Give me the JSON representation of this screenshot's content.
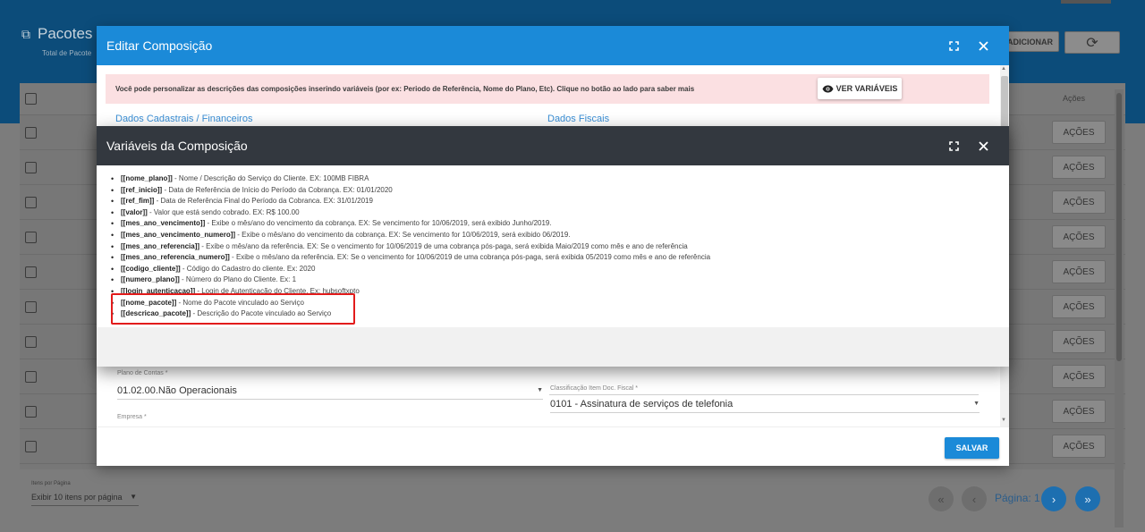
{
  "background": {
    "title": "Pacotes",
    "subtitle": "Total de Pacote",
    "add_button": "ADICIONAR",
    "refresh_icon": "refresh-icon",
    "acoes_header": "Ações",
    "row_action": "AÇÕES",
    "per_page_label": "Itens por Página",
    "per_page_value": "Exibir 10 itens por página",
    "page_label": "Página: 1"
  },
  "edit_modal": {
    "title": "Editar Composição",
    "alert_text": "Você pode personalizar as descrições das composições inserindo variáveis (por ex: Periodo de Referência, Nome do Plano, Etc). Clique no botão ao lado para saber mais",
    "ver_variaveis": "VER VARIÁVEIS",
    "tab_cadastrais": "Dados Cadastrais / Financeiros",
    "tab_fiscais": "Dados Fiscais",
    "plano_contas_label": "Plano de Contas *",
    "plano_contas_value": "01.02.00.Não Operacionais",
    "classificacao_label": "Classificação Item Doc. Fiscal *",
    "classificacao_value": "0101 - Assinatura de serviços de telefonia",
    "empresa_label": "Empresa *",
    "save_button": "SALVAR"
  },
  "vars_modal": {
    "title": "Variáveis da Composição",
    "items": [
      {
        "name": "[[nome_plano]]",
        "desc": " - Nome / Descrição do Serviço do Cliente. EX: 100MB FIBRA"
      },
      {
        "name": "[[ref_inicio]]",
        "desc": " - Data de Referência de Início do Período da Cobrança. EX: 01/01/2020"
      },
      {
        "name": "[[ref_fim]]",
        "desc": " - Data de Referência Final do Período da Cobranca. EX: 31/01/2019"
      },
      {
        "name": "[[valor]]",
        "desc": " - Valor que está sendo cobrado. EX: R$ 100.00"
      },
      {
        "name": "[[mes_ano_vencimento]]",
        "desc": " - Exibe o mês/ano do vencimento da cobrança. EX: Se vencimento for 10/06/2019, será exibido Junho/2019."
      },
      {
        "name": "[[mes_ano_vencimento_numero]]",
        "desc": " - Exibe o mês/ano do vencimento da cobrança. EX: Se vencimento for 10/06/2019, será exibido 06/2019."
      },
      {
        "name": "[[mes_ano_referencia]]",
        "desc": " - Exibe o mês/ano da referência. EX: Se o vencimento for 10/06/2019 de uma cobrança pós-paga, será exibida Maio/2019 como mês e ano de referência"
      },
      {
        "name": "[[mes_ano_referencia_numero]]",
        "desc": " - Exibe o mês/ano da referência. EX: Se o vencimento for 10/06/2019 de uma cobrança pós-paga, será exibida 05/2019 como mês e ano de referência"
      },
      {
        "name": "[[codigo_cliente]]",
        "desc": " - Código do Cadastro do cliente. Ex: 2020"
      },
      {
        "name": "[[numero_plano]]",
        "desc": " - Número do Plano do Cliente. Ex: 1"
      },
      {
        "name": "[[login_autenticacao]]",
        "desc": " - Login de Autenticação do Cliente. Ex: hubsoftxpto"
      },
      {
        "name": "[[nome_pacote]]",
        "desc": " - Nome do Pacote vinculado ao Serviço"
      },
      {
        "name": "[[descricao_pacote]]",
        "desc": " - Descrição do Pacote vinculado ao Serviço"
      }
    ]
  },
  "colors": {
    "edit_header": "#1b8ad8",
    "vars_header": "#33383f",
    "alert_bg": "#fbe0e2",
    "highlight": "#e21b1b"
  }
}
